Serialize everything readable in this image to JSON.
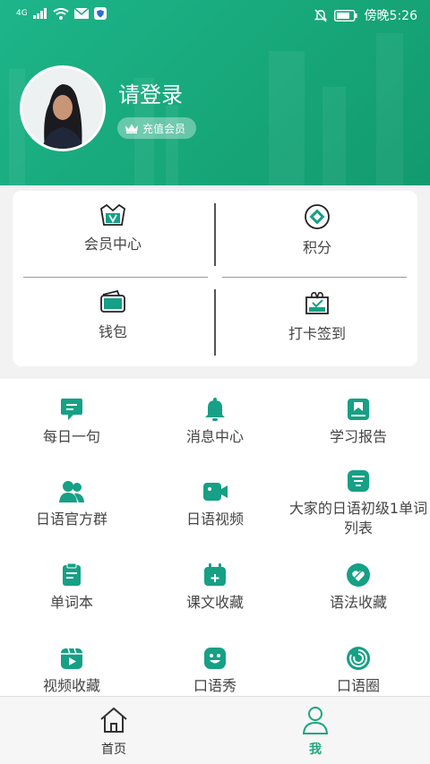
{
  "status_bar": {
    "network": "4G",
    "time_label": "傍晚5:26"
  },
  "profile": {
    "title": "请登录",
    "vip_button": "充值会员"
  },
  "quick_grid": [
    {
      "label": "会员中心",
      "icon": "vip-basket-icon"
    },
    {
      "label": "积分",
      "icon": "points-coin-icon"
    },
    {
      "label": "钱包",
      "icon": "wallet-icon"
    },
    {
      "label": "打卡签到",
      "icon": "checkin-gift-icon"
    }
  ],
  "features": [
    {
      "label": "每日一句",
      "icon": "chat-bubble-icon"
    },
    {
      "label": "消息中心",
      "icon": "bell-icon"
    },
    {
      "label": "学习报告",
      "icon": "report-icon"
    },
    {
      "label": "日语官方群",
      "icon": "group-icon"
    },
    {
      "label": "日语视频",
      "icon": "video-camera-icon"
    },
    {
      "label": "大家的日语初级1单词列表",
      "icon": "list-icon"
    },
    {
      "label": "单词本",
      "icon": "notebook-icon"
    },
    {
      "label": "课文收藏",
      "icon": "calendar-add-icon"
    },
    {
      "label": "语法收藏",
      "icon": "heart-icon"
    },
    {
      "label": "视频收藏",
      "icon": "video-play-icon"
    },
    {
      "label": "口语秀",
      "icon": "smile-face-icon"
    },
    {
      "label": "口语圈",
      "icon": "circle-ring-icon"
    }
  ],
  "bottom_nav": [
    {
      "label": "首页",
      "icon": "home-icon",
      "active": false
    },
    {
      "label": "我",
      "icon": "person-icon",
      "active": true
    }
  ],
  "colors": {
    "accent": "#1aa67c",
    "header_start": "#1db58a",
    "header_end": "#129a6e",
    "icon_teal": "#16a085"
  }
}
